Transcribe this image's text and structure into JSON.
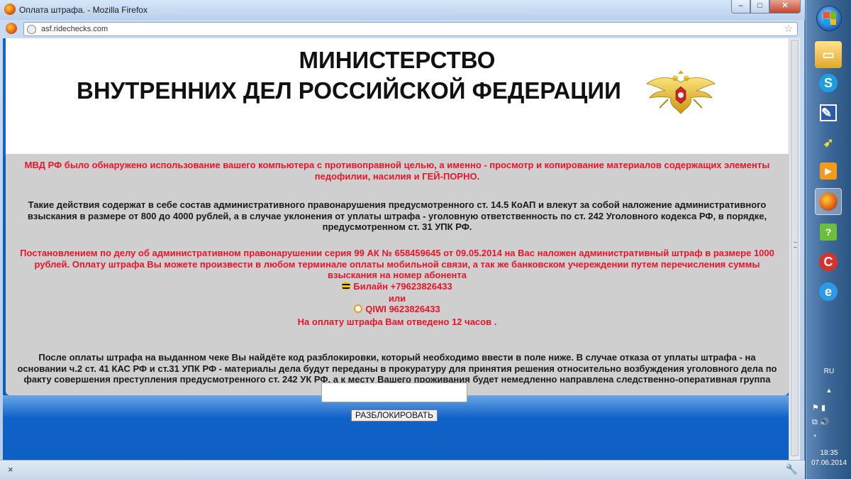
{
  "window": {
    "title": "Оплата штрафа. - Mozilla Firefox",
    "minimize": "–",
    "maximize": "□",
    "close": "✕"
  },
  "navbar": {
    "url": "asf.ridechecks.com",
    "bookmark_icon": "star-icon"
  },
  "header": {
    "line1": "МИНИСТЕРСТВО",
    "line2": "ВНУТРЕННИХ ДЕЛ РОССИЙСКОЙ ФЕДЕРАЦИИ",
    "emblem_icon": "double-headed-eagle-emblem"
  },
  "message": {
    "p1": "МВД РФ было обнаружено использование вашего компьютера с противоправной целью, а именно - просмотр и копирование материалов содержащих элементы педофилии, насилия и ГЕЙ-ПОРНО.",
    "p2": "Такие действия содержат в себе состав административного правонарушения предусмотренного ст. 14.5 КоАП и влекут за собой наложение административного взыскания в размере от 800 до 4000 рублей, а в случае уклонения от уплаты штрафа - уголовную ответственность по ст. 242 Уголовного кодекса РФ, в порядке, предусмотренном ст. 31 УПК РФ.",
    "p3": "Постановлением по делу об административном правонарушении серия 99 АК № 658459645 от 09.05.2014 на Вас наложен административный штраф в размере 1000 рублей. Оплату штрафа Вы можете произвести в любом терминале оплаты мобильной связи, а так же банковском учереждении путем перечисления суммы взыскания на номер абонента",
    "beeline_label": "Билайн   +79623826433",
    "or": "или",
    "qiwi_label": "QIWI   9623826433",
    "deadline": "На оплату штрафа Вам отведено 12 часов .",
    "p4": "После оплаты штрафа на выданном чеке Вы найдёте код разблокировки, который необходимо ввести в поле ниже. В случае отказа от уплаты штрафа - на основании ч.2 ст. 41 КАС РФ и ст.31 УПК РФ - материалы дела будут переданы в прокуратуру для принятия решения относительно возбуждения уголовного дела по факту совершения преступления предусмотренного ст. 242 УК РФ, а к месту Вашего проживания будет немедленно направлена следственно-оперативная группа для Вашего задержания!"
  },
  "unlock": {
    "input_value": "",
    "button_label": "РАЗБЛОКИРОВАТЬ"
  },
  "findbar": {
    "close": "×",
    "tool_icon": "wrench-icon"
  },
  "taskbar": {
    "lang": "RU",
    "arrow": "▲",
    "time": "18:35",
    "date": "07.06.2014"
  },
  "colors": {
    "alert_red": "#e8142a",
    "panel_gray": "#cfcfcf",
    "page_blue": "#1264c9"
  }
}
